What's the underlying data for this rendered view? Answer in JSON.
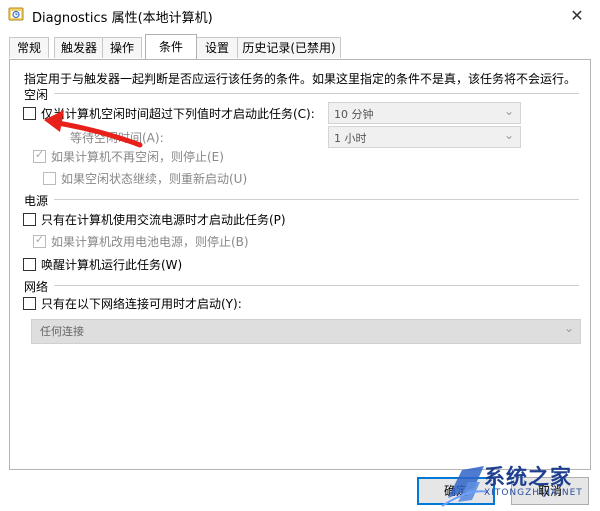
{
  "window": {
    "title": "Diagnostics 属性(本地计算机)",
    "close_symbol": "✕"
  },
  "tabs": [
    {
      "label": "常规",
      "active": false
    },
    {
      "label": "触发器",
      "active": false
    },
    {
      "label": "操作",
      "active": false
    },
    {
      "label": "条件",
      "active": true
    },
    {
      "label": "设置",
      "active": false
    },
    {
      "label": "历史记录(已禁用)",
      "active": false
    }
  ],
  "conditions": {
    "description": "指定用于与触发器一起判断是否应运行该任务的条件。如果这里指定的条件不是真，该任务将不会运行。",
    "idle": {
      "group_label": "空闲",
      "start_if_idle": {
        "label": "仅当计算机空闲时间超过下列值时才启动此任务(C):",
        "checked": false
      },
      "idle_duration": {
        "value": "10 分钟"
      },
      "wait_for_idle": {
        "label": "等待空闲时间(A):"
      },
      "wait_duration": {
        "value": "1 小时"
      },
      "stop_if_not_idle": {
        "label": "如果计算机不再空闲，则停止(E)",
        "checked": true
      },
      "restart_if_idle_resumes": {
        "label": "如果空闲状态继续，则重新启动(U)",
        "checked": false
      }
    },
    "power": {
      "group_label": "电源",
      "start_on_ac": {
        "label": "只有在计算机使用交流电源时才启动此任务(P)",
        "checked": false
      },
      "stop_on_battery": {
        "label": "如果计算机改用电池电源，则停止(B)",
        "checked": true
      },
      "wake_to_run": {
        "label": "唤醒计算机运行此任务(W)",
        "checked": false
      }
    },
    "network": {
      "group_label": "网络",
      "start_if_network": {
        "label": "只有在以下网络连接可用时才启动(Y):",
        "checked": false
      },
      "connection": {
        "value": "任何连接"
      }
    }
  },
  "buttons": {
    "ok": "确定",
    "cancel": "取消"
  },
  "watermark": {
    "text": "系统之家",
    "sub": "XITONGZHIJIA.NET"
  },
  "colors": {
    "annotation_arrow": "#e8201a",
    "accent": "#0078d7"
  },
  "icons": {
    "app": "task-scheduler-icon",
    "close": "close-icon",
    "dropdown": "chevron-down-icon"
  }
}
